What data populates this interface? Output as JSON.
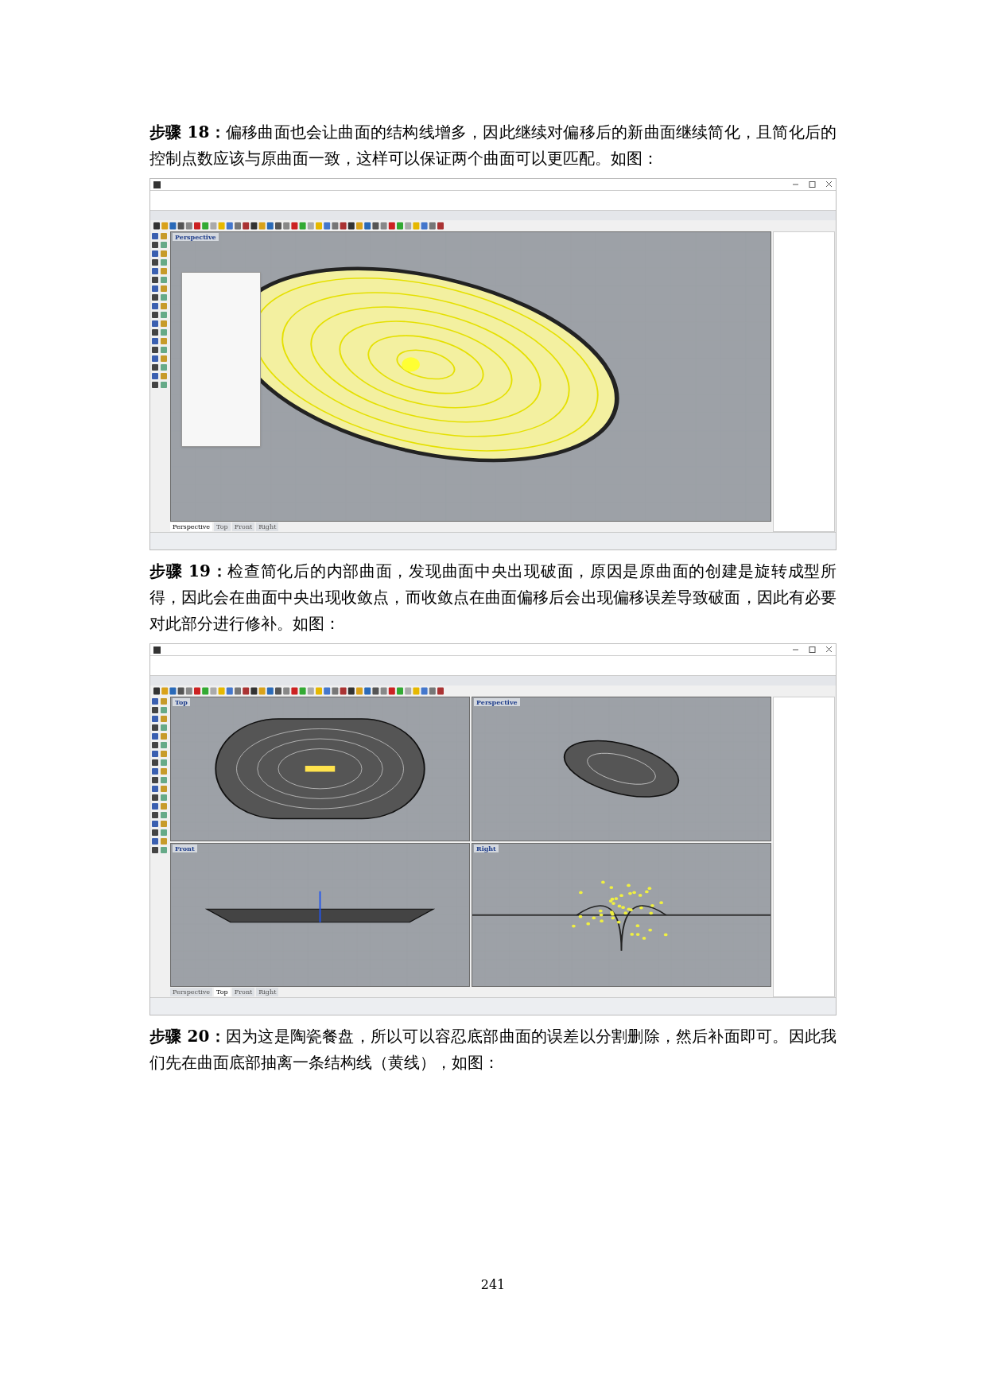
{
  "paragraphs": [
    {
      "text": "**步骤 18：**偏移曲面也会让曲面的结构线增多，因此继续对偏移后的新曲面继续简化，且简化后的控制点数应该与原曲面一致，这样可以保证两个曲面可以更匹配。如图："
    },
    {
      "text": "**步骤 19：**检查简化后的内部曲面，发现曲面中央出现破面，原因是原曲面的创建是旋转成型所得，因此会在曲面中央出现收敛点，而收敛点在曲面偏移后会出现偏移误差导致破面，因此有必要对此部分进行修补。如图："
    },
    {
      "text": "**步骤 20：**因为这是陶瓷餐盘，所以可以容忍底部曲面的误差以分割删除，然后补面即可。因此我们先在曲面底部抽离一条结构线（黄线），如图："
    }
  ],
  "figures": [
    {
      "dialog": true,
      "viewports": [
        {
          "label": "Perspective",
          "kind": "dish-perspective"
        }
      ],
      "viewport_tabs": [
        {
          "label": "Perspective",
          "selected": true
        },
        {
          "label": "Top",
          "selected": false
        },
        {
          "label": "Front",
          "selected": false
        },
        {
          "label": "Right",
          "selected": false
        }
      ]
    },
    {
      "dialog": false,
      "viewports": [
        {
          "label": "Top",
          "kind": "top"
        },
        {
          "label": "Perspective",
          "kind": "small-perspective"
        },
        {
          "label": "Front",
          "kind": "front"
        },
        {
          "label": "Right",
          "kind": "right"
        }
      ],
      "viewport_tabs": [
        {
          "label": "Perspective",
          "selected": false
        },
        {
          "label": "Top",
          "selected": true
        },
        {
          "label": "Front",
          "selected": false
        },
        {
          "label": "Right",
          "selected": false
        }
      ]
    }
  ],
  "page_number": "241"
}
